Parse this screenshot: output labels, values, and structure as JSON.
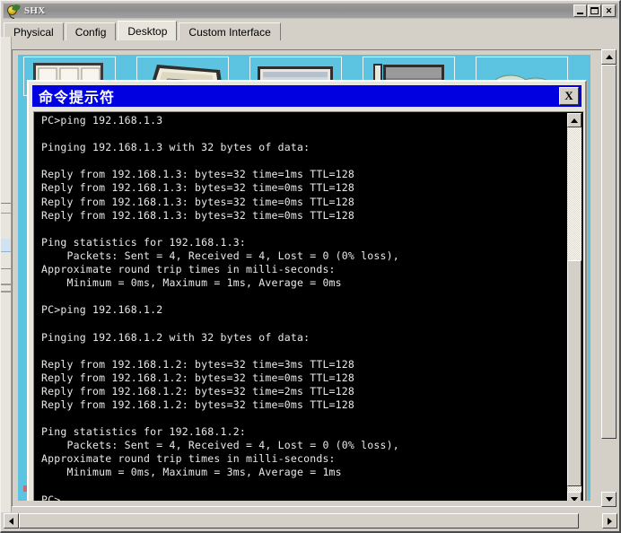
{
  "window": {
    "title": "SHX",
    "icon": "packet-tracer-icon",
    "buttons": {
      "minimize": "_",
      "maximize": "□",
      "close": "✕"
    }
  },
  "tabs": [
    {
      "label": "Physical",
      "active": false
    },
    {
      "label": "Config",
      "active": false
    },
    {
      "label": "Desktop",
      "active": true
    },
    {
      "label": "Custom Interface",
      "active": false
    }
  ],
  "desktop": {
    "background_color": "#5cc3e0",
    "icons": [
      {
        "name": "ip-configuration-icon"
      },
      {
        "name": "dial-up-icon"
      },
      {
        "name": "terminal-icon"
      },
      {
        "name": "command-prompt-icon"
      },
      {
        "name": "web-browser-icon"
      }
    ]
  },
  "cmd_window": {
    "title": "命令提示符",
    "title_bar_color": "#0000e0",
    "close_label": "X",
    "terminal_background": "#000000",
    "terminal_foreground": "#e9e9e9",
    "terminal_lines": [
      "PC>ping 192.168.1.3",
      "",
      "Pinging 192.168.1.3 with 32 bytes of data:",
      "",
      "Reply from 192.168.1.3: bytes=32 time=1ms TTL=128",
      "Reply from 192.168.1.3: bytes=32 time=0ms TTL=128",
      "Reply from 192.168.1.3: bytes=32 time=0ms TTL=128",
      "Reply from 192.168.1.3: bytes=32 time=0ms TTL=128",
      "",
      "Ping statistics for 192.168.1.3:",
      "    Packets: Sent = 4, Received = 4, Lost = 0 (0% loss),",
      "Approximate round trip times in milli-seconds:",
      "    Minimum = 0ms, Maximum = 1ms, Average = 0ms",
      "",
      "PC>ping 192.168.1.2",
      "",
      "Pinging 192.168.1.2 with 32 bytes of data:",
      "",
      "Reply from 192.168.1.2: bytes=32 time=3ms TTL=128",
      "Reply from 192.168.1.2: bytes=32 time=0ms TTL=128",
      "Reply from 192.168.1.2: bytes=32 time=2ms TTL=128",
      "Reply from 192.168.1.2: bytes=32 time=0ms TTL=128",
      "",
      "Ping statistics for 192.168.1.2:",
      "    Packets: Sent = 4, Received = 4, Lost = 0 (0% loss),",
      "Approximate round trip times in milli-seconds:",
      "    Minimum = 0ms, Maximum = 3ms, Average = 1ms",
      "",
      "PC>"
    ]
  },
  "scrollbars": {
    "terminal_vertical": {
      "orientation": "vertical",
      "up_arrow": "▲",
      "down_arrow": "▼"
    },
    "desktop_vertical": {
      "orientation": "vertical",
      "up_arrow": "▲",
      "down_arrow": "▼"
    },
    "desktop_horizontal": {
      "orientation": "horizontal",
      "left_arrow": "◀",
      "right_arrow": "▶"
    }
  }
}
